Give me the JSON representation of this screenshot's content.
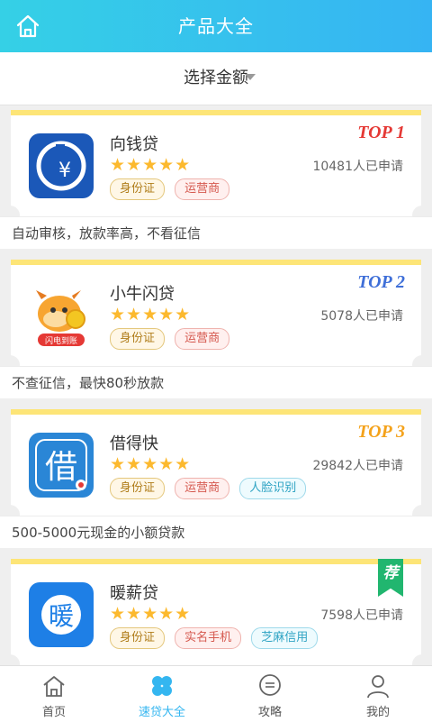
{
  "header": {
    "title": "产品大全"
  },
  "filter": {
    "label": "选择金额"
  },
  "products": [
    {
      "name": "向钱贷",
      "stars": "★★★★★",
      "applied": "10481人已申请",
      "rank": "TOP 1",
      "rank_color": "#e53935",
      "tags": [
        "身份证",
        "运营商"
      ],
      "desc": "自动审核，放款率高，不看征信"
    },
    {
      "name": "小牛闪贷",
      "stars": "★★★★★",
      "applied": "5078人已申请",
      "rank": "TOP 2",
      "rank_color": "#3f6fd8",
      "icon_text": "闪电到账",
      "tags": [
        "身份证",
        "运营商"
      ],
      "desc": "不查征信，最快80秒放款"
    },
    {
      "name": "借得快",
      "stars": "★★★★★",
      "applied": "29842人已申请",
      "rank": "TOP 3",
      "rank_color": "#f4a21b",
      "icon_text": "借",
      "tags": [
        "身份证",
        "运营商",
        "人脸识别"
      ],
      "desc": "500-5000元现金的小额贷款"
    },
    {
      "name": "暖薪贷",
      "stars": "★★★★★",
      "applied": "7598人已申请",
      "badge": "荐",
      "icon_text": "暖",
      "tags": [
        "身份证",
        "实名手机",
        "芝麻信用"
      ]
    }
  ],
  "tabbar": [
    {
      "label": "首页",
      "icon": "home-icon"
    },
    {
      "label": "速贷大全",
      "icon": "clover-icon"
    },
    {
      "label": "攻略",
      "icon": "chat-icon"
    },
    {
      "label": "我的",
      "icon": "user-icon"
    }
  ],
  "colors": {
    "accent": "#34b6f0",
    "star": "#fcb92e",
    "card_top": "#fde577"
  }
}
